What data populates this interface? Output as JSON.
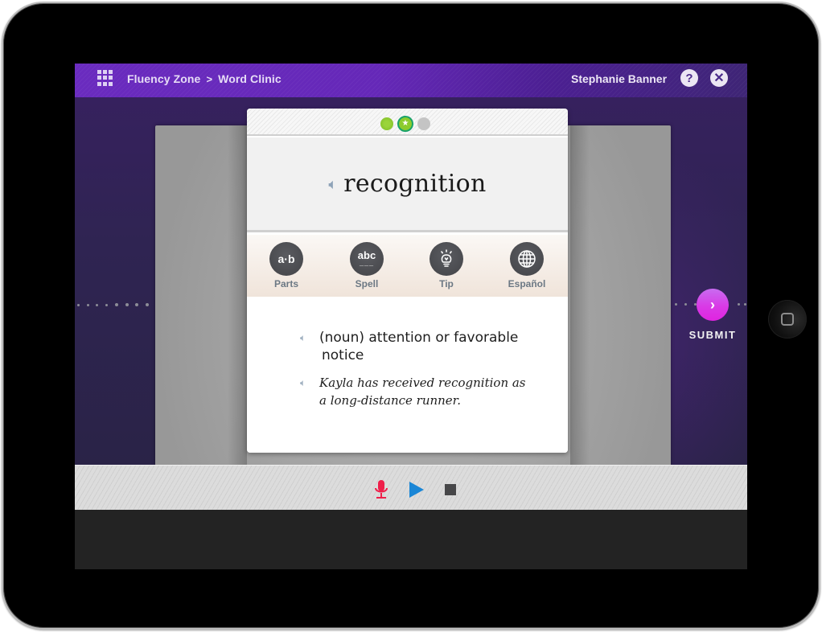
{
  "header": {
    "menu_icon": "apps-grid-icon",
    "breadcrumb": [
      "Fluency Zone",
      "Word Clinic"
    ],
    "breadcrumb_separator": ">",
    "user_name": "Stephanie Banner",
    "help_label": "?",
    "close_label": "✕"
  },
  "progress": {
    "steps": [
      "completed",
      "current",
      "pending"
    ],
    "current_marker": "★"
  },
  "word_card": {
    "word": "recognition",
    "audio_icon": "speaker-icon"
  },
  "tools": [
    {
      "label": "Parts",
      "glyph": "a·b",
      "icon": "parts-icon"
    },
    {
      "label": "Spell",
      "glyph": "abc",
      "icon": "spell-icon"
    },
    {
      "label": "Tip",
      "glyph": "💡",
      "icon": "lightbulb-icon"
    },
    {
      "label": "Español",
      "glyph": "🌐",
      "icon": "globe-icon"
    }
  ],
  "definition": {
    "line1": "(noun) attention or favorable",
    "line2": "notice"
  },
  "example": {
    "line1": "Kayla has received recognition as",
    "line2": "a long-distance runner."
  },
  "submit": {
    "label": "SUBMIT",
    "arrow": "›"
  },
  "recorder": {
    "mic_icon": "microphone-icon",
    "play_icon": "play-icon",
    "stop_icon": "stop-icon"
  },
  "colors": {
    "header_purple": "#6a2bbf",
    "submit_magenta": "#e024e0",
    "mic_red": "#ef1f4a",
    "play_blue": "#1a86d6",
    "progress_green": "#8ccb2d"
  }
}
